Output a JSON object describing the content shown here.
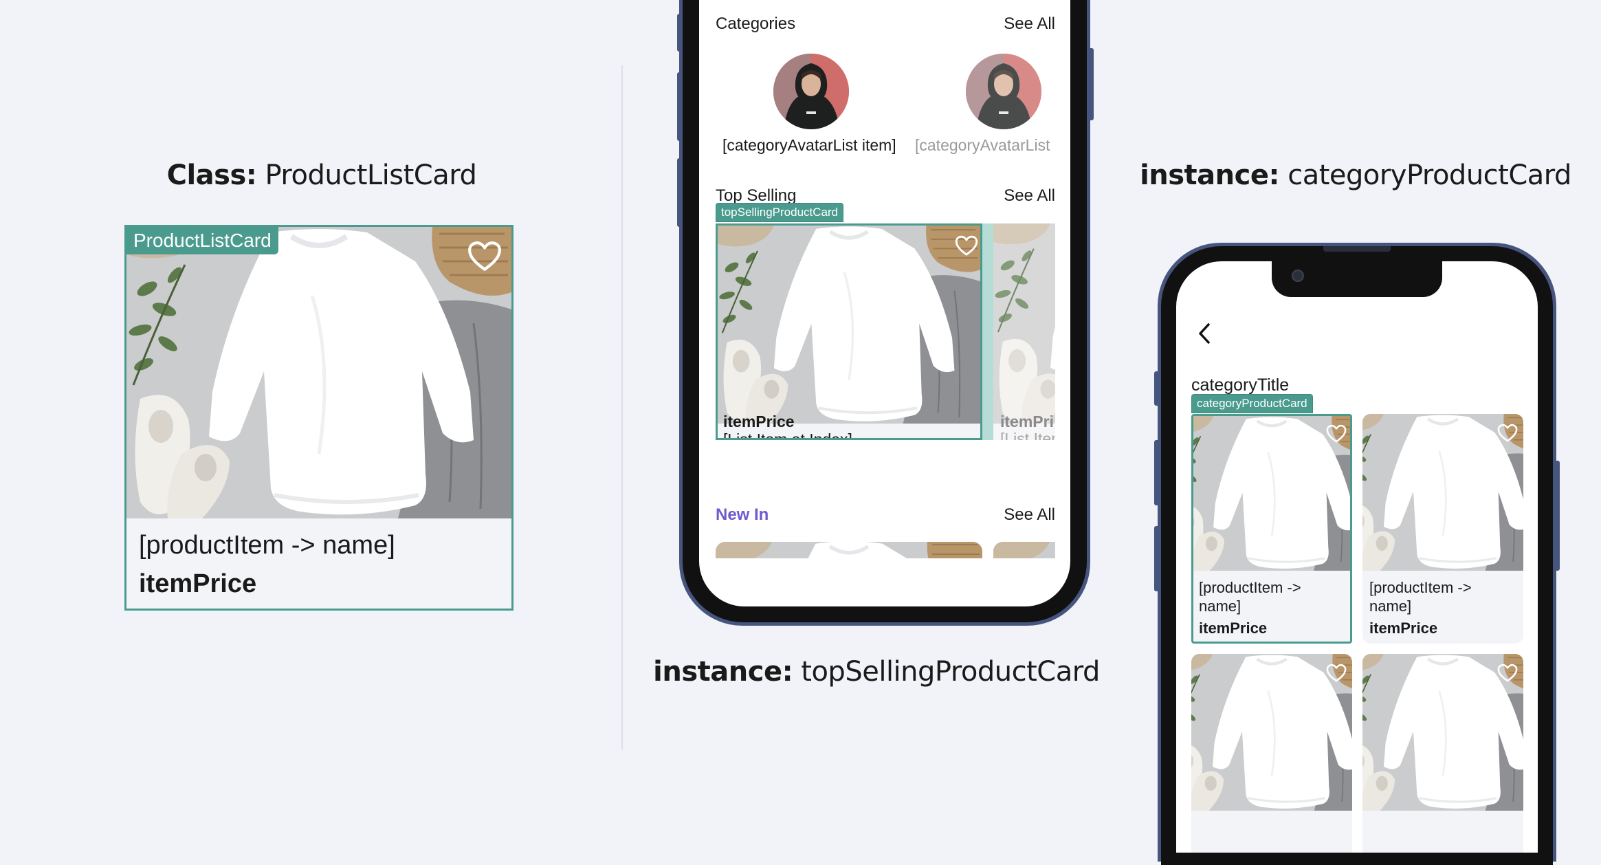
{
  "headings": {
    "class": {
      "bold": "Class:",
      "rest": " ProductListCard"
    },
    "top": {
      "bold": "instance:",
      "rest": " topSellingProductCard"
    },
    "category": {
      "bold": "instance:",
      "rest": " categoryProductCard"
    }
  },
  "class_card": {
    "tag": "ProductListCard",
    "name": "[productItem -> name]",
    "price": "itemPrice",
    "heart_icon": "heart-outline-icon"
  },
  "phone1": {
    "categories": {
      "title": "Categories",
      "see_all": "See All"
    },
    "avatars": [
      {
        "label": "[categoryAvatarList item]"
      },
      {
        "label": "[categoryAvatarList"
      }
    ],
    "top_selling": {
      "title": "Top Selling",
      "see_all": "See All",
      "tag": "topSellingProductCard"
    },
    "cards": [
      {
        "name": "[List Item at Index]",
        "price": "itemPrice"
      },
      {
        "name": "[List Item",
        "price": "itemPri"
      }
    ],
    "new_in": {
      "title": "New In",
      "see_all": "See All"
    }
  },
  "phone2": {
    "back_icon": "chevron-left-icon",
    "title": "categoryTitle",
    "tag": "categoryProductCard",
    "cards": [
      {
        "name": "[productItem -> name]",
        "price": "itemPrice"
      },
      {
        "name": "[productItem -> name]",
        "price": "itemPrice"
      },
      {
        "name": "",
        "price": ""
      },
      {
        "name": "",
        "price": ""
      }
    ]
  },
  "colors": {
    "background": "#f1f3f8",
    "tag_teal": "#4a9b8e",
    "phone_frame": "#46557e",
    "new_in_accent": "#6d5bd0"
  }
}
